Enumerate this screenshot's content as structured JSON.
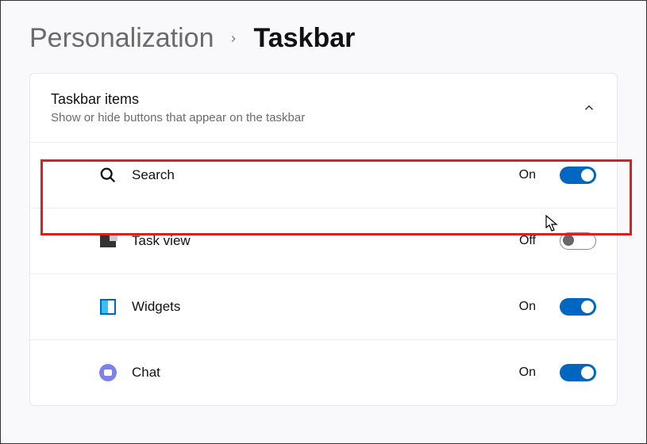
{
  "breadcrumb": {
    "parent": "Personalization",
    "current": "Taskbar"
  },
  "panel": {
    "title": "Taskbar items",
    "subtitle": "Show or hide buttons that appear on the taskbar"
  },
  "items": [
    {
      "icon": "search-icon",
      "label": "Search",
      "status": "On",
      "on": true
    },
    {
      "icon": "taskview-icon",
      "label": "Task view",
      "status": "Off",
      "on": false
    },
    {
      "icon": "widgets-icon",
      "label": "Widgets",
      "status": "On",
      "on": true
    },
    {
      "icon": "chat-icon",
      "label": "Chat",
      "status": "On",
      "on": true
    }
  ]
}
